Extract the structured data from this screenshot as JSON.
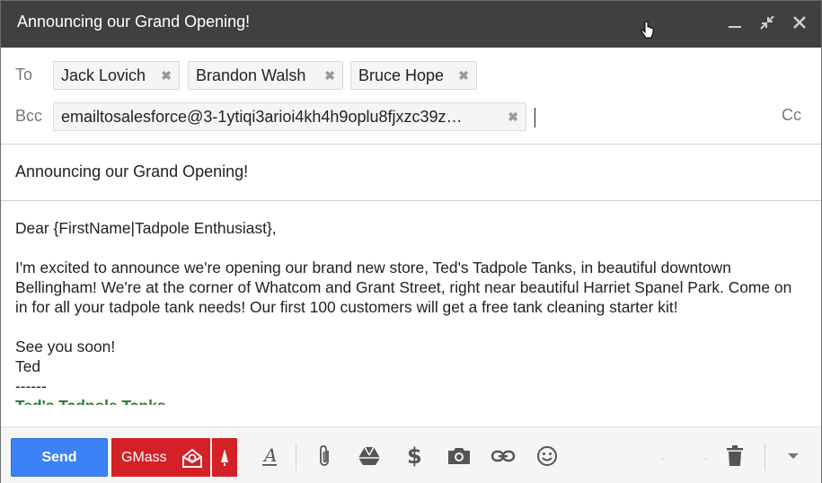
{
  "window": {
    "title": "Announcing our Grand Opening!",
    "minimize_icon": "minimize-icon",
    "popout_icon": "shrink-icon",
    "close_icon": "close-icon"
  },
  "recipients": {
    "to_label": "To",
    "to": [
      "Jack Lovich",
      "Brandon Walsh",
      "Bruce Hope"
    ],
    "bcc_label": "Bcc",
    "bcc": [
      "emailtosalesforce@3-1ytiqi3arioi4kh4h9oplu8fjxzc39z…"
    ],
    "cc_label": "Cc"
  },
  "subject": "Announcing our Grand Opening!",
  "body": {
    "greeting": "Dear {FirstName|Tadpole Enthusiast},",
    "paragraph": "I'm excited to announce we're opening our brand new store, Ted's Tadpole Tanks, in beautiful downtown Bellingham! We're at the corner of Whatcom and Grant Street, right near beautiful Harriet Spanel Park. Come on in for all your tadpole tank needs! Our first 100 customers will get a free tank cleaning starter kit!",
    "closing": "See you soon!",
    "name": "Ted",
    "separator": "------",
    "signature": "Ted's Tadpole Tanks"
  },
  "toolbar": {
    "send_label": "Send",
    "gmass_label": "GMass",
    "icons": [
      "formatting-icon",
      "attach-icon",
      "drive-icon",
      "money-icon",
      "photo-icon",
      "link-icon",
      "emoji-icon",
      "trash-icon",
      "more-options-icon"
    ]
  },
  "colors": {
    "titlebar": "#404040",
    "send": "#3b82f6",
    "gmass": "#d42027"
  }
}
